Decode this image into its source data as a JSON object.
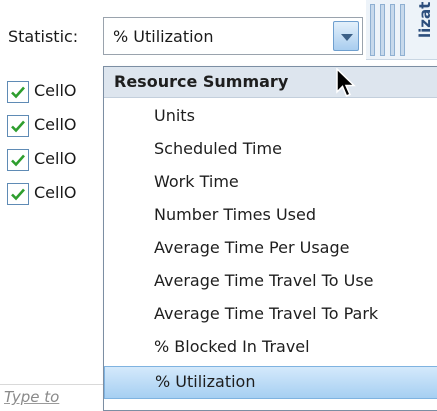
{
  "statistic": {
    "label": "Statistic:",
    "selected_value": "% Utilization"
  },
  "side_panel": {
    "visible_text": "lizat"
  },
  "checklist": {
    "items": [
      {
        "label": "CellO",
        "checked": true
      },
      {
        "label": "CellO",
        "checked": true
      },
      {
        "label": "CellO",
        "checked": true
      },
      {
        "label": "CellO",
        "checked": true
      }
    ]
  },
  "search": {
    "placeholder": "Type to"
  },
  "dropdown": {
    "group_header": "Resource Summary",
    "options": [
      {
        "label": "Units",
        "selected": false
      },
      {
        "label": "Scheduled Time",
        "selected": false
      },
      {
        "label": "Work Time",
        "selected": false
      },
      {
        "label": "Number Times Used",
        "selected": false
      },
      {
        "label": "Average Time Per Usage",
        "selected": false
      },
      {
        "label": "Average Time Travel To Use",
        "selected": false
      },
      {
        "label": "Average Time Travel To Park",
        "selected": false
      },
      {
        "label": "% Blocked In Travel",
        "selected": false
      },
      {
        "label": "% Utilization",
        "selected": true
      }
    ]
  },
  "colors": {
    "accent": "#a6cff2",
    "header_bg": "#dde5ee",
    "checkbox_green": "#2e9e2e"
  },
  "icons": {
    "dropdown_button": "chevron-down-icon",
    "checkbox": "checkmark-icon",
    "cursor": "mouse-pointer-icon"
  }
}
